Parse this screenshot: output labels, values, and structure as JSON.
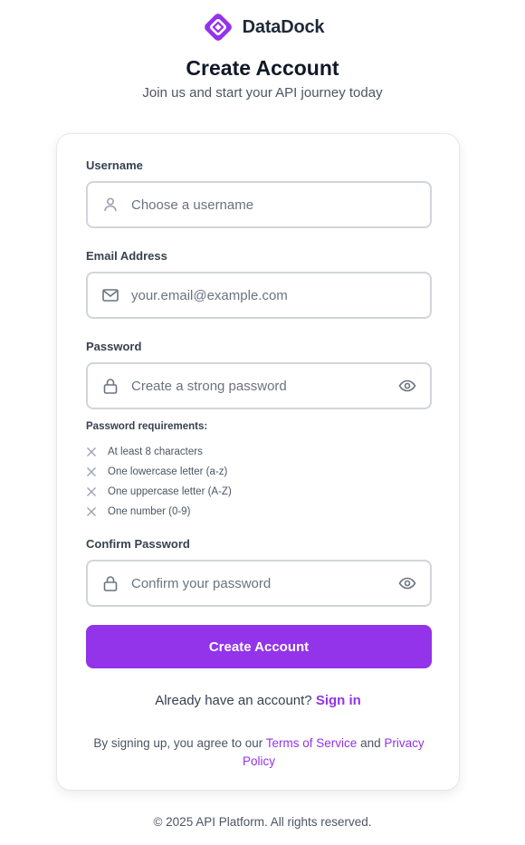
{
  "brand": {
    "name": "DataDock",
    "logo_icon": "diamond-link-logo",
    "accent": "#9333ea"
  },
  "header": {
    "title": "Create Account",
    "subtitle": "Join us and start your API journey today"
  },
  "form": {
    "username": {
      "label": "Username",
      "placeholder": "Choose a username",
      "icon": "user-icon"
    },
    "email": {
      "label": "Email Address",
      "placeholder": "your.email@example.com",
      "icon": "mail-icon"
    },
    "password": {
      "label": "Password",
      "placeholder": "Create a strong password",
      "icon": "lock-icon",
      "toggle_icon": "eye-icon"
    },
    "requirements": {
      "title": "Password requirements:",
      "items": [
        {
          "text": "At least 8 characters",
          "met": false
        },
        {
          "text": "One lowercase letter (a-z)",
          "met": false
        },
        {
          "text": "One uppercase letter (A-Z)",
          "met": false
        },
        {
          "text": "One number (0-9)",
          "met": false
        }
      ]
    },
    "confirm_password": {
      "label": "Confirm Password",
      "placeholder": "Confirm your password",
      "icon": "lock-icon",
      "toggle_icon": "eye-icon"
    },
    "submit_label": "Create Account"
  },
  "signin": {
    "prompt": "Already have an account?",
    "link": "Sign in"
  },
  "legal": {
    "prefix": "By signing up, you agree to our",
    "terms": "Terms of Service",
    "and": "and",
    "privacy": "Privacy Policy"
  },
  "footer": {
    "copyright": "© 2025 API Platform. All rights reserved."
  }
}
